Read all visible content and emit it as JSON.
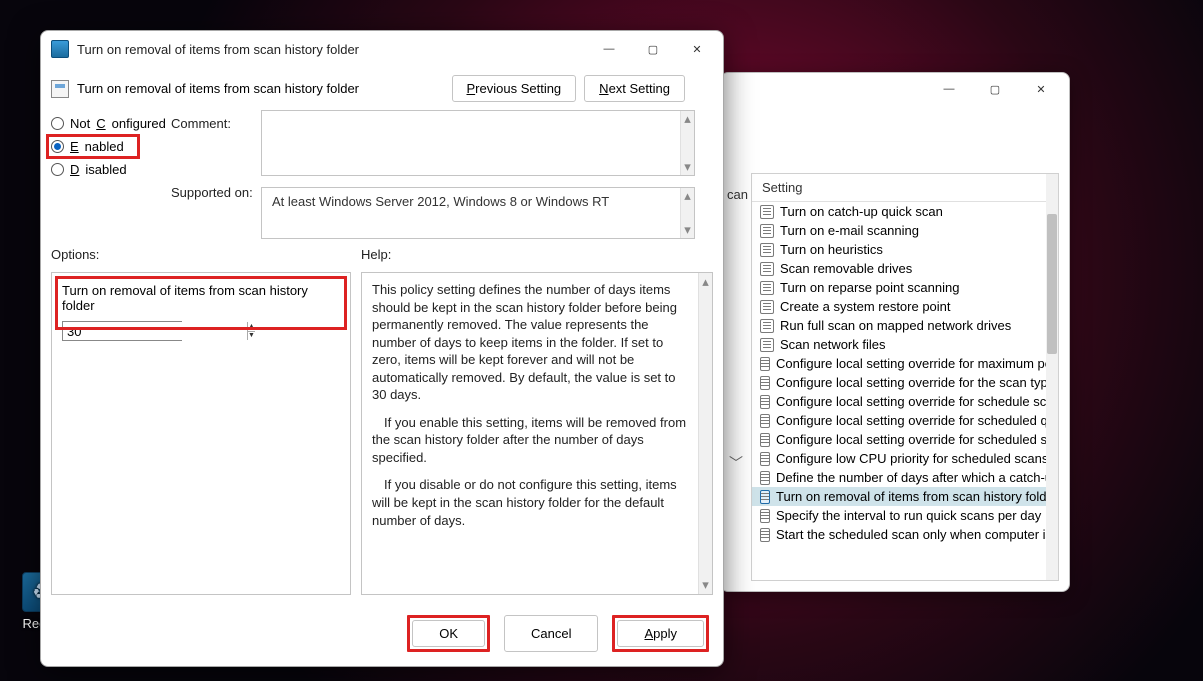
{
  "desktop": {
    "recycle_label": "Recycl"
  },
  "bg_window": {
    "scan_tag": "can",
    "col_header": "Setting",
    "items": [
      "Turn on catch-up quick scan",
      "Turn on e-mail scanning",
      "Turn on heuristics",
      "Scan removable drives",
      "Turn on reparse point scanning",
      "Create a system restore point",
      "Run full scan on mapped network drives",
      "Scan network files",
      "Configure local setting override for maximum perce",
      "Configure local setting override for the scan type to",
      "Configure local setting override for schedule scan da",
      "Configure local setting override for scheduled quick",
      "Configure local setting override for scheduled scan t",
      "Configure low CPU priority for scheduled scans",
      "Define the number of days after which a catch-up sc",
      "Turn on removal of items from scan history folder",
      "Specify the interval to run quick scans per day",
      "Start the scheduled scan only when computer is on t"
    ],
    "selected_index": 15
  },
  "dialog": {
    "title": "Turn on removal of items from scan history folder",
    "subtitle": "Turn on removal of items from scan history folder",
    "nav": {
      "prev_pre": "P",
      "prev_rest": "revious Setting",
      "next_pre": "N",
      "next_rest": "ext Setting"
    },
    "radios": {
      "not_configured_pre": "C",
      "not_configured_label": "Not ",
      "not_configured_rest": "onfigured",
      "enabled_pre": "E",
      "enabled_rest": "nabled",
      "disabled_pre": "D",
      "disabled_rest": "isabled",
      "selected": "enabled"
    },
    "comment_label": "Comment:",
    "supported_label": "Supported on:",
    "supported_text": "At least Windows Server 2012, Windows 8 or Windows RT",
    "options_label": "Options:",
    "help_label": "Help:",
    "option_title": "Turn on removal of items from scan history folder",
    "option_value": "30",
    "help": {
      "p1": "This policy setting defines the number of days items should be kept in the scan history folder before being permanently removed. The value represents the number of days to keep items in the folder. If set to zero, items will be kept forever and will not be automatically removed. By default, the value is set to 30 days.",
      "p2": "If you enable this setting, items will be removed from the scan history folder after the number of days specified.",
      "p3": "If you disable or do not configure this setting, items will be kept in the scan history folder for the default number of days."
    },
    "buttons": {
      "ok": "OK",
      "cancel": "Cancel",
      "apply_pre": "A",
      "apply_rest": "pply"
    }
  }
}
